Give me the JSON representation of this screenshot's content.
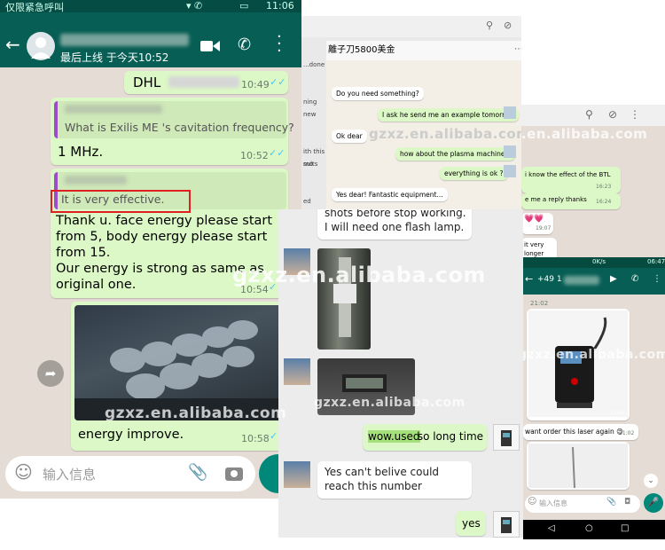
{
  "left_chat": {
    "status_bar_text": "仅限紧急呼叫",
    "status_time": "11:06",
    "last_seen": "最后上线 于今天10:52",
    "messages": {
      "dhl_text": "DHL",
      "dhl_time": "10:49",
      "quote1": "What is Exilis ME 's cavitation frequency?",
      "reply1": "1 MHz.",
      "reply1_time": "10:52",
      "quote2": "It is very effective.",
      "reply2": "Thank u. face energy please start from 5, body energy please start from 15.\nOur energy is strong as same as original one.",
      "reply2_time": "10:54",
      "caption": "energy improve.",
      "caption_time": "10:58"
    },
    "input_placeholder": "输入信息",
    "accent": "#075e54"
  },
  "mid_top_chat": {
    "header": "離子刀5800美金",
    "messages": [
      {
        "side": "in",
        "text": "Do you need something?"
      },
      {
        "side": "out",
        "text": "I ask he send me an example  tomorrow"
      },
      {
        "side": "in",
        "text": "Ok dear"
      },
      {
        "side": "out",
        "text": "how about the plasma machine ?"
      },
      {
        "side": "out",
        "text": "everything is ok ?"
      },
      {
        "side": "in",
        "text": "Yes dear! Fantastic equipment..."
      }
    ],
    "side_snippets": [
      "ning new ",
      "ith this mo",
      "sults",
      "ed portable"
    ],
    "date_snippet": "...done"
  },
  "right_top_chat": {
    "messages": [
      {
        "text": "i know the effect of the BTL",
        "time": "16:23"
      },
      {
        "text": "e me a reply thanks",
        "time": "16:24"
      }
    ],
    "emoji_time": "19:07",
    "snippet_lines": [
      "it very",
      "longer"
    ]
  },
  "mid_bottom_chat": {
    "top_text": "shots before stop working.\nI will need one flash lamp.",
    "out1_highlight": "wow.used",
    "out1_rest": " so long time",
    "in_text": "Yes can't belive could reach this number",
    "out2": "yes"
  },
  "right_bottom_chat": {
    "status_speed": "0K/s",
    "status_time": "06:47",
    "contact": "+49 1",
    "date1": "21:02",
    "image_time": "21:07",
    "msg": "want order this laser again 😊",
    "msg_time": "21:02",
    "input_placeholder": "输入信息"
  },
  "watermark": "gzxz.en.alibaba.com"
}
